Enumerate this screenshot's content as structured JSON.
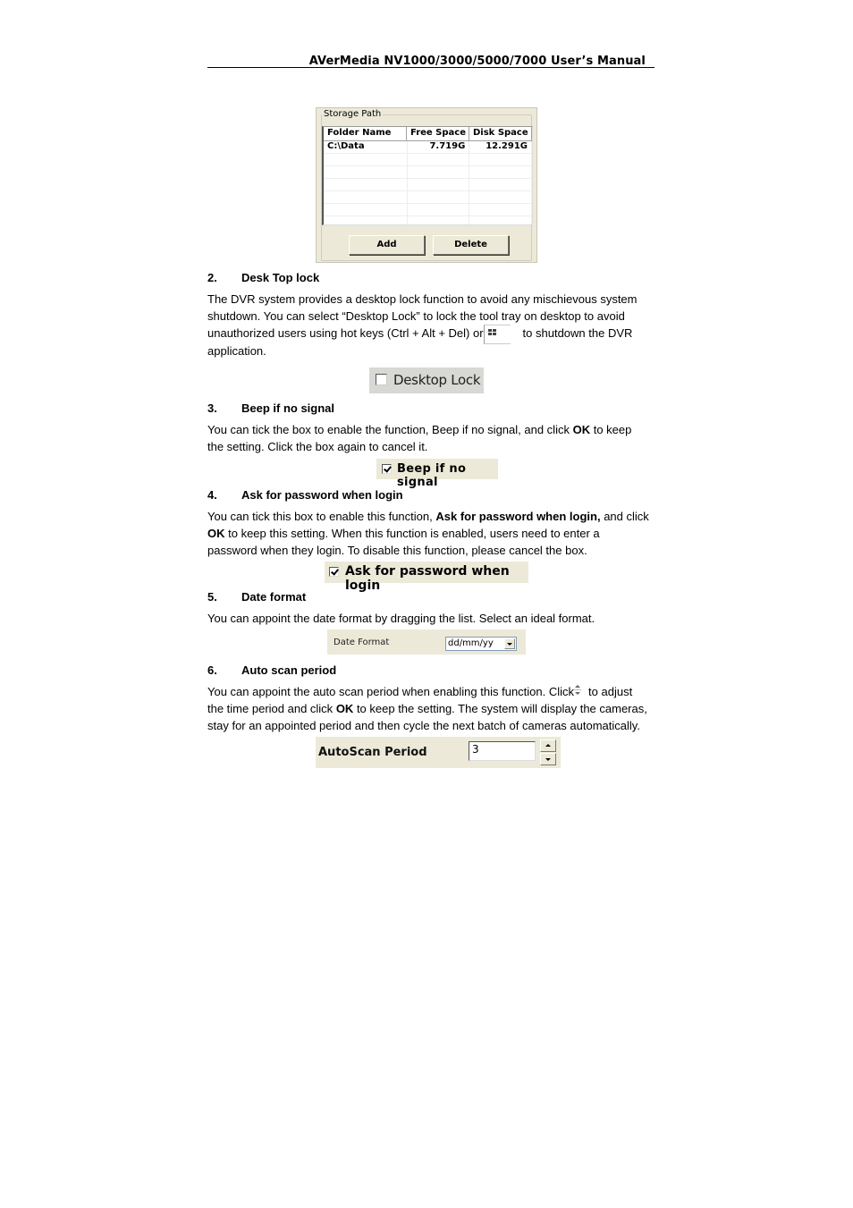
{
  "header": {
    "title": "AVerMedia NV1000/3000/5000/7000 User’s Manual"
  },
  "storage_path": {
    "group_label": "Storage Path",
    "columns": [
      "Folder Name",
      "Free Space",
      "Disk Space"
    ],
    "rows": [
      {
        "folder": "C:\\Data",
        "free": "7.719G",
        "disk": "12.291G"
      }
    ],
    "add_label": "Add",
    "delete_label": "Delete"
  },
  "sections": [
    {
      "number": "2.",
      "title": "Desk Top lock",
      "para_parts": [
        "The DVR system provides a desktop lock function to avoid any mischievous system shutdown. You can select “Desktop Lock” to lock the tool tray on desktop to avoid unauthorized users using hot keys (Ctrl + Alt + Del) or",
        "to shutdown the DVR application."
      ],
      "inline_icon": "windows-shutdown-icon",
      "control": {
        "label": "Desktop Lock",
        "checked": false
      }
    },
    {
      "number": "3.",
      "title": "Beep if no signal",
      "para_parts": [
        "You can tick the box to enable the function, Beep if no signal, and click",
        "OK",
        "to keep the setting. Click the box again to cancel it."
      ],
      "control": {
        "label": "Beep if no signal",
        "checked": true
      }
    },
    {
      "number": "4.",
      "title": "Ask for password when login",
      "para_parts": [
        "You can tick this box to enable this function,",
        "Ask for password when login,",
        "and click",
        "OK",
        "to keep this setting. When this function is enabled, users need to enter a password when they login. To disable this function, please cancel the box."
      ],
      "control": {
        "label": "Ask for password when login",
        "checked": true
      }
    },
    {
      "number": "5.",
      "title": "Date format",
      "para_parts": [
        "You can appoint the date format by dragging the list. Select an ideal format."
      ],
      "control": {
        "label": "Date Format",
        "selected": "dd/mm/yy"
      }
    },
    {
      "number": "6.",
      "title": "Auto scan period",
      "para_parts": [
        "You can appoint the auto scan period when enabling this function. Click",
        "to adjust the time period and click",
        "OK",
        "to keep the setting. The system will display the cameras, stay for an appointed period and then cycle the next batch of cameras automatically."
      ],
      "inline_icon": "spin-arrows-icon",
      "control": {
        "label": "AutoScan Period",
        "value": "3"
      }
    }
  ]
}
